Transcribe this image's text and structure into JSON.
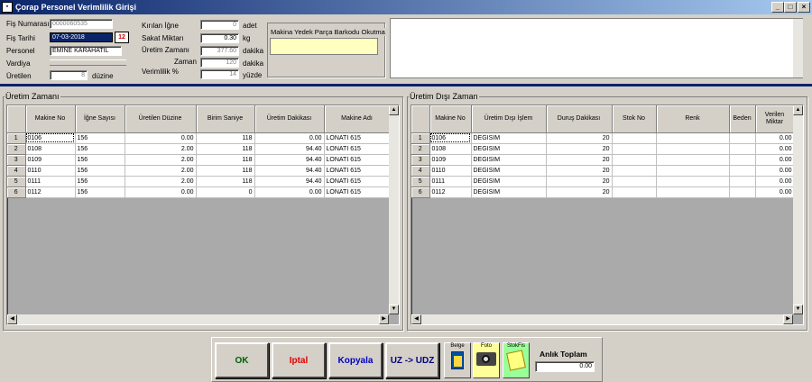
{
  "window": {
    "title": "Çorap Personel Verimlilik Girişi",
    "app_icon": "app-icon"
  },
  "header": {
    "fis_numarasi": {
      "label": "Fiş Numarası",
      "value": "0000060535"
    },
    "fis_tarihi": {
      "label": "Fiş Tarihi",
      "value": "07-03-2018",
      "calendar_icon": "calendar-icon"
    },
    "personel": {
      "label": "Personel",
      "value": "EMİNE KARAHATIL"
    },
    "vardiya": {
      "label": "Vardiya",
      "value": ""
    },
    "uretilen": {
      "label": "Üretilen",
      "value": "8",
      "unit": "düzine"
    },
    "kirilan_igne": {
      "label": "Kırılan İğne",
      "value": "0",
      "unit": "adet"
    },
    "sakat_miktari": {
      "label": "Sakat Miktarı",
      "value": "0.30",
      "unit": "kg"
    },
    "uretim_zamani": {
      "label": "Üretim Zamanı",
      "value": "377.60",
      "unit": "dakika"
    },
    "zaman": {
      "label": "Zaman",
      "value": "120",
      "unit": "dakika"
    },
    "verimlilik": {
      "label": "Verimlilik %",
      "value": "14",
      "unit": "yüzde"
    },
    "barcode": {
      "label": "Makina Yedek Parça Barkodu Okutma",
      "value": ""
    }
  },
  "uretim": {
    "title": "Üretim Zamanı",
    "columns": [
      "Makine No",
      "İğne Sayısı",
      "Üretilen Düzine",
      "Birim Saniye",
      "Üretim Dakikası",
      "Makine Adı"
    ],
    "rows": [
      [
        "1",
        "0106",
        "156",
        "0.00",
        "118",
        "0.00",
        "LONATI 615"
      ],
      [
        "2",
        "0108",
        "156",
        "2.00",
        "118",
        "94.40",
        "LONATI 615"
      ],
      [
        "3",
        "0109",
        "156",
        "2.00",
        "118",
        "94.40",
        "LONATI 615"
      ],
      [
        "4",
        "0110",
        "156",
        "2.00",
        "118",
        "94.40",
        "LONATI 615"
      ],
      [
        "5",
        "0111",
        "156",
        "2.00",
        "118",
        "94.40",
        "LONATI 615"
      ],
      [
        "6",
        "0112",
        "156",
        "0.00",
        "0",
        "0.00",
        "LONATI 615"
      ]
    ]
  },
  "uretim_disi": {
    "title": "Üretim Dışı Zaman",
    "columns": [
      "Makine No",
      "Üretim Dışı İşlem",
      "Duruş Dakikası",
      "Stok No",
      "Renk",
      "Beden",
      "Verilen Miktar"
    ],
    "rows": [
      [
        "1",
        "0106",
        "DEGISIM",
        "20",
        "",
        "",
        "",
        "0.00"
      ],
      [
        "2",
        "0108",
        "DEGISIM",
        "20",
        "",
        "",
        "",
        "0.00"
      ],
      [
        "3",
        "0109",
        "DEGISIM",
        "20",
        "",
        "",
        "",
        "0.00"
      ],
      [
        "4",
        "0110",
        "DEGISIM",
        "20",
        "",
        "",
        "",
        "0.00"
      ],
      [
        "5",
        "0111",
        "DEGISIM",
        "20",
        "",
        "",
        "",
        "0.00"
      ],
      [
        "6",
        "0112",
        "DEGISIM",
        "20",
        "",
        "",
        "",
        "0.00"
      ]
    ]
  },
  "buttons": {
    "ok": "OK",
    "iptal": "Iptal",
    "kopyala": "Kopyala",
    "uz_udz": "UZ -> UDZ",
    "belge": "Belge",
    "foto": "Foto",
    "stokfis": "StokFis",
    "anlik_toplam_label": "Anlık Toplam",
    "anlik_toplam_value": "0.00"
  },
  "colors": {
    "titlebar": "#0a246a",
    "ok": "#006000",
    "iptal": "#e00000",
    "kopyala": "#0000c0",
    "uzudz": "#000080",
    "foto_bg": "#ffff99",
    "stokfis_bg": "#99ff99"
  }
}
